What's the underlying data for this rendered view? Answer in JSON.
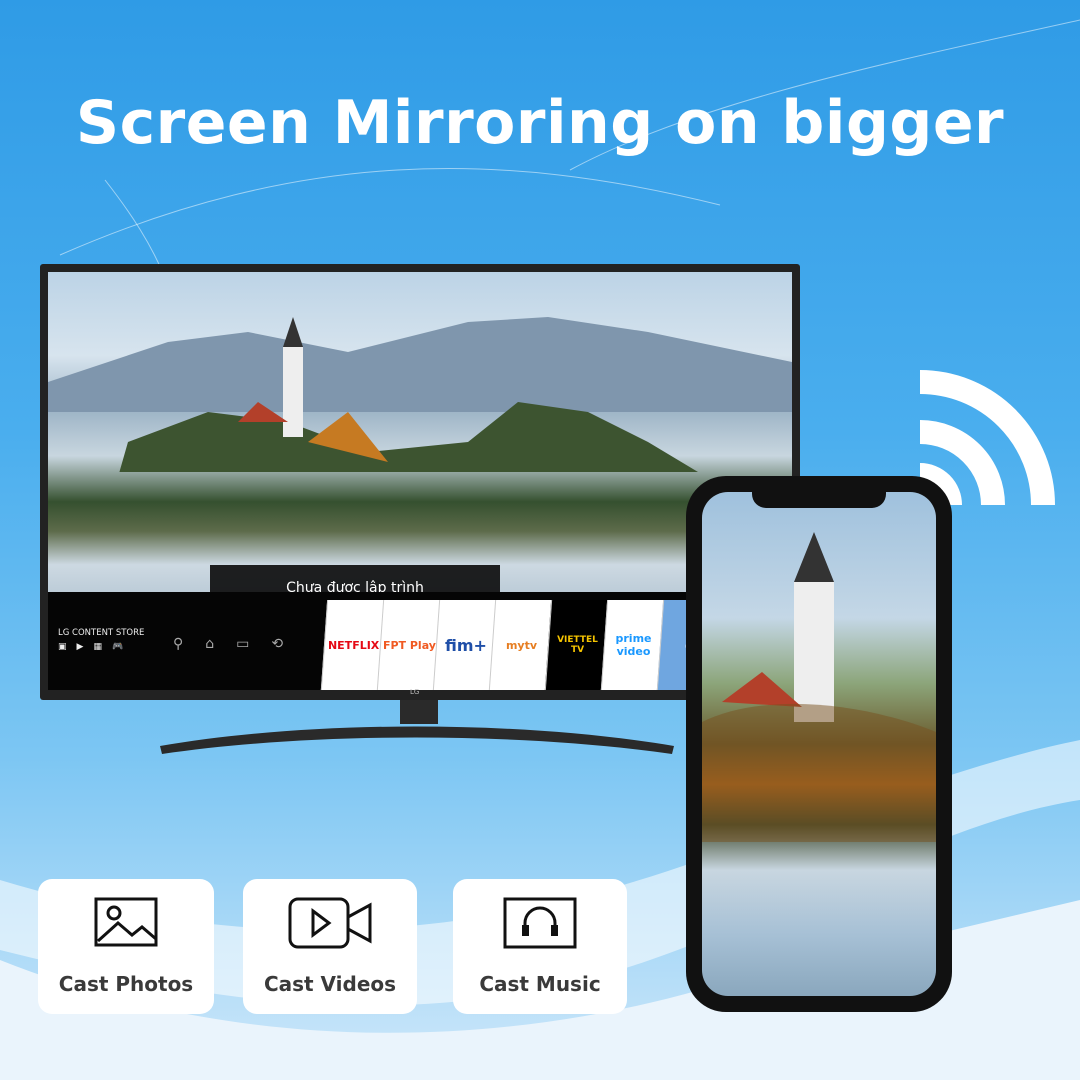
{
  "headline": "Screen Mirroring on bigger",
  "tv": {
    "popup_text": "Chưa được lập trình",
    "content_store_label": "LG CONTENT STORE",
    "brand": "LG",
    "apps": [
      {
        "name": "NETFLIX",
        "color": "#e50914"
      },
      {
        "name": "FPT Play",
        "color": "#f05a22"
      },
      {
        "name": "fim+",
        "color": "#1f4fa8"
      },
      {
        "name": "mytv",
        "color": "#e67e22"
      },
      {
        "name": "VIETTEL TV",
        "color": "#f5c400"
      },
      {
        "name": "prime video",
        "color": "#1a98ff"
      }
    ]
  },
  "features": [
    {
      "label": "Cast Photos",
      "icon": "image-icon"
    },
    {
      "label": "Cast Videos",
      "icon": "video-camera-icon"
    },
    {
      "label": "Cast Music",
      "icon": "headphones-icon"
    }
  ],
  "colors": {
    "background": "#3aa3ea",
    "text": "#ffffff",
    "card": "#ffffff"
  }
}
